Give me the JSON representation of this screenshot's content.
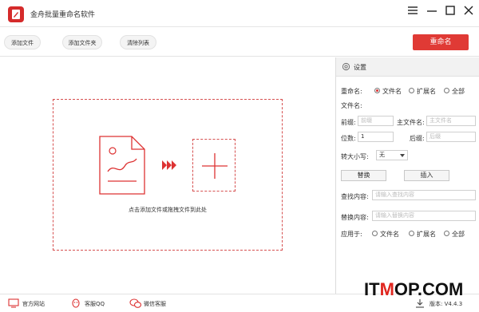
{
  "app": {
    "title": "金舟批量重命名软件"
  },
  "toolbar": {
    "add_file": "添加文件",
    "add_folder": "添加文件夹",
    "clear_list": "清除列表",
    "rename": "重命名"
  },
  "dropzone": {
    "hint": "点击添加文件或拖拽文件到此处"
  },
  "settings": {
    "title": "设置",
    "rename_label": "重命名:",
    "rename_options": [
      "文件名",
      "扩展名",
      "全部"
    ],
    "rename_selected": "文件名",
    "filename_label": "文件名:",
    "prefix_label": "前缀:",
    "prefix_placeholder": "前缀",
    "main_name_label": "主文件名:",
    "main_name_placeholder": "主文件名",
    "digits_label": "位数:",
    "digits_value": "1",
    "suffix_label": "后缀:",
    "suffix_placeholder": "后缀",
    "case_label": "转大小写:",
    "case_value": "无",
    "replace_button": "替换",
    "insert_button": "插入",
    "find_label": "查找内容:",
    "find_placeholder": "请输入查找内容",
    "replace_label": "替换内容:",
    "replace_placeholder": "请输入替换内容",
    "apply_label": "应用于:",
    "apply_options": [
      "文件名",
      "扩展名",
      "全部"
    ]
  },
  "status": {
    "website": "官方网站",
    "qq": "客服QQ",
    "wechat": "微信客服",
    "version": "版本: V4.4.3"
  },
  "watermark": {
    "part1": "IT",
    "part2": "M",
    "part3": "OP.COM"
  },
  "colors": {
    "accent": "#e03a35",
    "dash": "#d65050"
  }
}
